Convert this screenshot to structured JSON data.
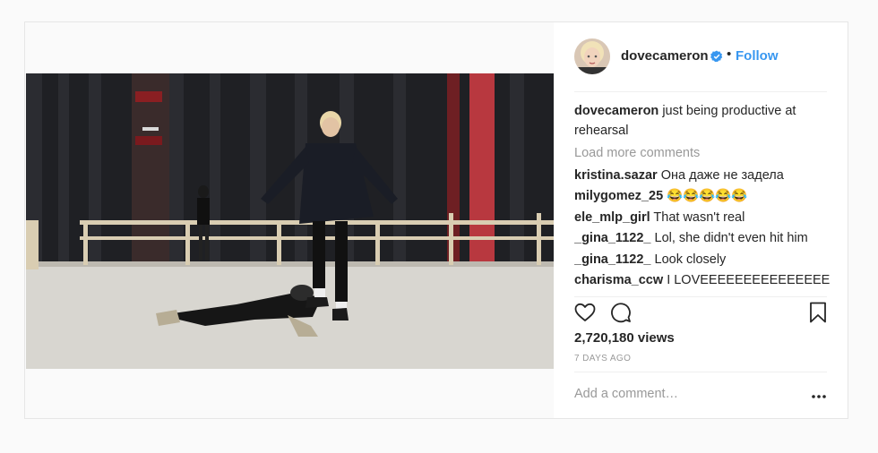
{
  "post": {
    "username": "dovecameron",
    "separator": "•",
    "follow_label": "Follow",
    "caption": {
      "user": "dovecameron",
      "text": "just being productive at rehearsal"
    },
    "load_more_label": "Load more comments",
    "comments": [
      {
        "user": "kristina.sazar",
        "text": "Она даже не задела"
      },
      {
        "user": "milygomez_25",
        "text": "😂😂😂😂😂"
      },
      {
        "user": "ele_mlp_girl",
        "text": "That wasn't real"
      },
      {
        "user": "_gina_1122_",
        "text": "Lol, she didn't even hit him"
      },
      {
        "user": "_gina_1122_",
        "text": "Look closely"
      },
      {
        "user": "charisma_ccw",
        "text": "I LOVEEEEEEEEEEEEEEEEEEEEEEEEEEEEEEEEEEE"
      }
    ],
    "views": "2,720,180 views",
    "time_ago": "7 DAYS AGO",
    "add_comment_placeholder": "Add a comment…"
  },
  "colors": {
    "link_blue": "#3897f0",
    "verified_blue": "#3897f0",
    "muted_text": "#999999",
    "border": "#e6e6e6"
  },
  "icons": [
    "verified-badge-icon",
    "heart-icon",
    "comment-icon",
    "bookmark-icon",
    "more-options-icon"
  ]
}
